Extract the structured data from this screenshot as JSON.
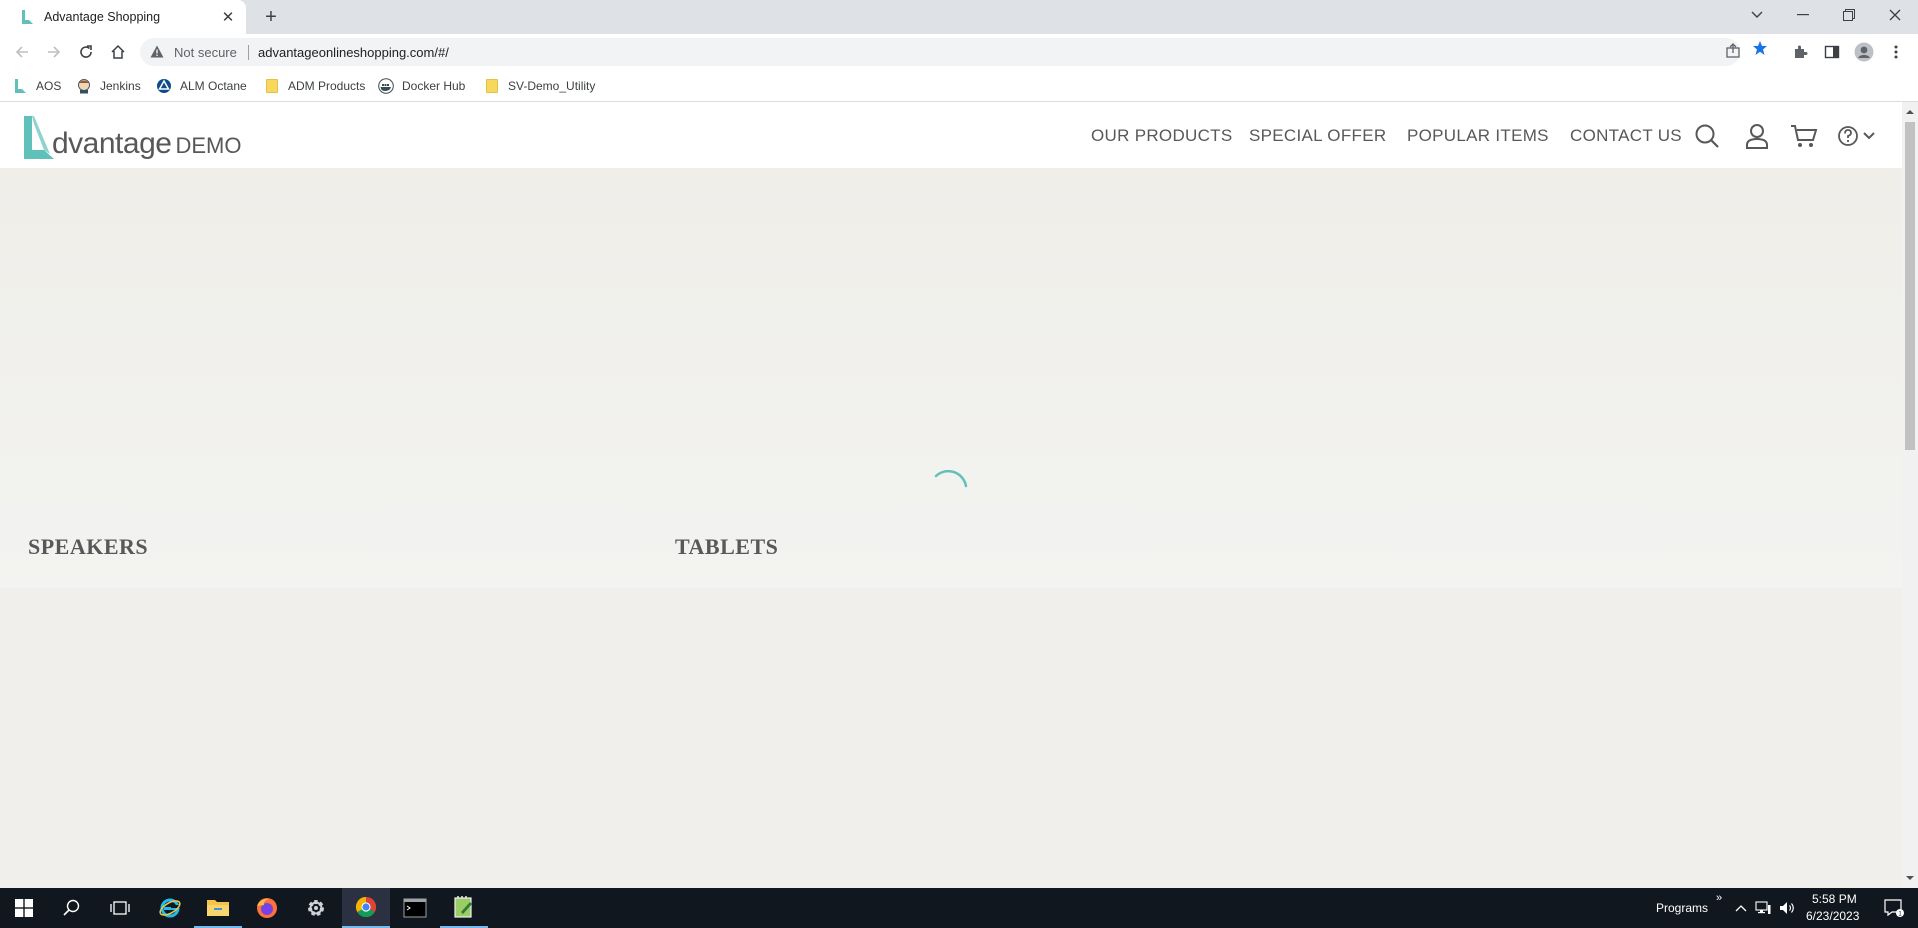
{
  "browser": {
    "tab_title": "Advantage Shopping",
    "new_tab": "+",
    "security_label": "Not secure",
    "url": "advantageonlineshopping.com/#/"
  },
  "bookmarks": [
    {
      "label": "AOS",
      "icon": "aos-logo-icon"
    },
    {
      "label": "Jenkins",
      "icon": "jenkins-icon"
    },
    {
      "label": "ALM Octane",
      "icon": "octane-icon"
    },
    {
      "label": "ADM Products",
      "icon": "folder-icon"
    },
    {
      "label": "Docker Hub",
      "icon": "docker-icon"
    },
    {
      "label": "SV-Demo_Utility",
      "icon": "folder-icon"
    }
  ],
  "site": {
    "logo_word": "dvantage",
    "logo_demo": "DEMO",
    "nav": [
      "OUR PRODUCTS",
      "SPECIAL OFFER",
      "POPULAR ITEMS",
      "CONTACT US"
    ],
    "categories": [
      "SPEAKERS",
      "TABLETS"
    ],
    "accent_color": "#5fc1ba",
    "loading": true
  },
  "taskbar": {
    "programs_label": "Programs",
    "chevron": "»",
    "time": "5:58 PM",
    "date": "6/23/2023"
  }
}
